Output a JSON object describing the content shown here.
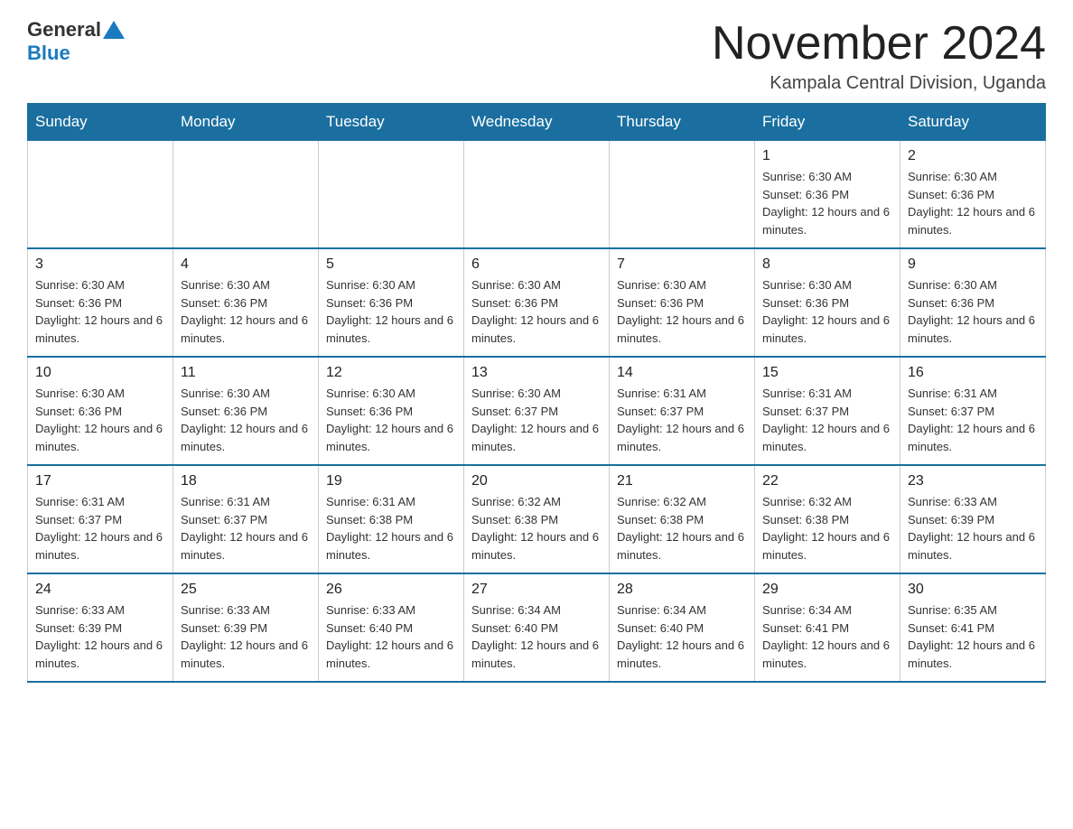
{
  "header": {
    "logo_general": "General",
    "logo_blue": "Blue",
    "month_title": "November 2024",
    "location": "Kampala Central Division, Uganda"
  },
  "weekdays": [
    "Sunday",
    "Monday",
    "Tuesday",
    "Wednesday",
    "Thursday",
    "Friday",
    "Saturday"
  ],
  "weeks": [
    [
      {
        "day": "",
        "info": ""
      },
      {
        "day": "",
        "info": ""
      },
      {
        "day": "",
        "info": ""
      },
      {
        "day": "",
        "info": ""
      },
      {
        "day": "",
        "info": ""
      },
      {
        "day": "1",
        "info": "Sunrise: 6:30 AM\nSunset: 6:36 PM\nDaylight: 12 hours and 6 minutes."
      },
      {
        "day": "2",
        "info": "Sunrise: 6:30 AM\nSunset: 6:36 PM\nDaylight: 12 hours and 6 minutes."
      }
    ],
    [
      {
        "day": "3",
        "info": "Sunrise: 6:30 AM\nSunset: 6:36 PM\nDaylight: 12 hours and 6 minutes."
      },
      {
        "day": "4",
        "info": "Sunrise: 6:30 AM\nSunset: 6:36 PM\nDaylight: 12 hours and 6 minutes."
      },
      {
        "day": "5",
        "info": "Sunrise: 6:30 AM\nSunset: 6:36 PM\nDaylight: 12 hours and 6 minutes."
      },
      {
        "day": "6",
        "info": "Sunrise: 6:30 AM\nSunset: 6:36 PM\nDaylight: 12 hours and 6 minutes."
      },
      {
        "day": "7",
        "info": "Sunrise: 6:30 AM\nSunset: 6:36 PM\nDaylight: 12 hours and 6 minutes."
      },
      {
        "day": "8",
        "info": "Sunrise: 6:30 AM\nSunset: 6:36 PM\nDaylight: 12 hours and 6 minutes."
      },
      {
        "day": "9",
        "info": "Sunrise: 6:30 AM\nSunset: 6:36 PM\nDaylight: 12 hours and 6 minutes."
      }
    ],
    [
      {
        "day": "10",
        "info": "Sunrise: 6:30 AM\nSunset: 6:36 PM\nDaylight: 12 hours and 6 minutes."
      },
      {
        "day": "11",
        "info": "Sunrise: 6:30 AM\nSunset: 6:36 PM\nDaylight: 12 hours and 6 minutes."
      },
      {
        "day": "12",
        "info": "Sunrise: 6:30 AM\nSunset: 6:36 PM\nDaylight: 12 hours and 6 minutes."
      },
      {
        "day": "13",
        "info": "Sunrise: 6:30 AM\nSunset: 6:37 PM\nDaylight: 12 hours and 6 minutes."
      },
      {
        "day": "14",
        "info": "Sunrise: 6:31 AM\nSunset: 6:37 PM\nDaylight: 12 hours and 6 minutes."
      },
      {
        "day": "15",
        "info": "Sunrise: 6:31 AM\nSunset: 6:37 PM\nDaylight: 12 hours and 6 minutes."
      },
      {
        "day": "16",
        "info": "Sunrise: 6:31 AM\nSunset: 6:37 PM\nDaylight: 12 hours and 6 minutes."
      }
    ],
    [
      {
        "day": "17",
        "info": "Sunrise: 6:31 AM\nSunset: 6:37 PM\nDaylight: 12 hours and 6 minutes."
      },
      {
        "day": "18",
        "info": "Sunrise: 6:31 AM\nSunset: 6:37 PM\nDaylight: 12 hours and 6 minutes."
      },
      {
        "day": "19",
        "info": "Sunrise: 6:31 AM\nSunset: 6:38 PM\nDaylight: 12 hours and 6 minutes."
      },
      {
        "day": "20",
        "info": "Sunrise: 6:32 AM\nSunset: 6:38 PM\nDaylight: 12 hours and 6 minutes."
      },
      {
        "day": "21",
        "info": "Sunrise: 6:32 AM\nSunset: 6:38 PM\nDaylight: 12 hours and 6 minutes."
      },
      {
        "day": "22",
        "info": "Sunrise: 6:32 AM\nSunset: 6:38 PM\nDaylight: 12 hours and 6 minutes."
      },
      {
        "day": "23",
        "info": "Sunrise: 6:33 AM\nSunset: 6:39 PM\nDaylight: 12 hours and 6 minutes."
      }
    ],
    [
      {
        "day": "24",
        "info": "Sunrise: 6:33 AM\nSunset: 6:39 PM\nDaylight: 12 hours and 6 minutes."
      },
      {
        "day": "25",
        "info": "Sunrise: 6:33 AM\nSunset: 6:39 PM\nDaylight: 12 hours and 6 minutes."
      },
      {
        "day": "26",
        "info": "Sunrise: 6:33 AM\nSunset: 6:40 PM\nDaylight: 12 hours and 6 minutes."
      },
      {
        "day": "27",
        "info": "Sunrise: 6:34 AM\nSunset: 6:40 PM\nDaylight: 12 hours and 6 minutes."
      },
      {
        "day": "28",
        "info": "Sunrise: 6:34 AM\nSunset: 6:40 PM\nDaylight: 12 hours and 6 minutes."
      },
      {
        "day": "29",
        "info": "Sunrise: 6:34 AM\nSunset: 6:41 PM\nDaylight: 12 hours and 6 minutes."
      },
      {
        "day": "30",
        "info": "Sunrise: 6:35 AM\nSunset: 6:41 PM\nDaylight: 12 hours and 6 minutes."
      }
    ]
  ]
}
